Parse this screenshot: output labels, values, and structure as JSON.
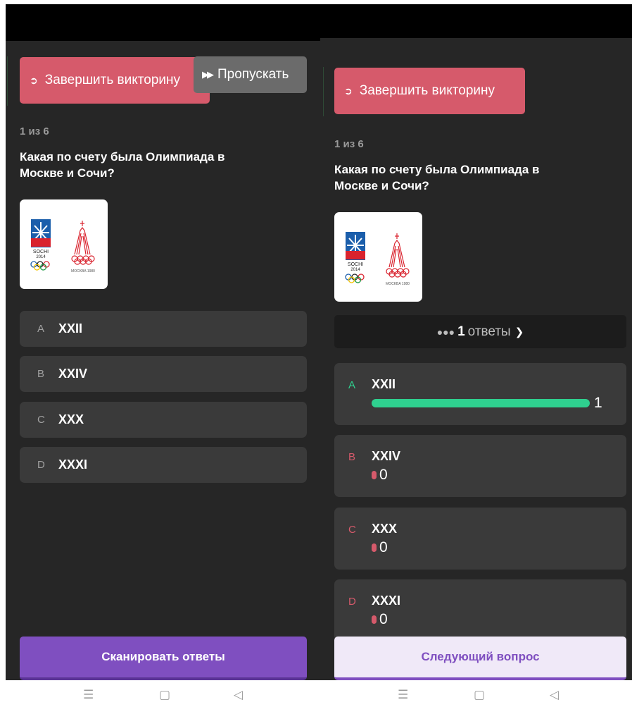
{
  "left": {
    "exit_label": "Завершить викторину",
    "skip_label": "Пропускать",
    "counter": "1 из 6",
    "question": "Какая по счету была Олимпиада в Москве и Сочи?",
    "options": [
      {
        "letter": "A",
        "text": "XXII"
      },
      {
        "letter": "B",
        "text": "XXIV"
      },
      {
        "letter": "C",
        "text": "XXX"
      },
      {
        "letter": "D",
        "text": "XXXI"
      }
    ],
    "scan_label": "Сканировать ответы"
  },
  "right": {
    "exit_label": "Завершить викторину",
    "counter": "1 из 6",
    "question": "Какая по счету была Олимпиада в Москве и Сочи?",
    "answers_count": "1",
    "answers_label": "ответы",
    "options": [
      {
        "letter": "A",
        "text": "XXII",
        "count": "1",
        "share": 1.0,
        "correct": true
      },
      {
        "letter": "B",
        "text": "XXIV",
        "count": "0",
        "share": 0.0,
        "correct": false
      },
      {
        "letter": "C",
        "text": "XXX",
        "count": "0",
        "share": 0.0,
        "correct": false
      },
      {
        "letter": "D",
        "text": "XXXI",
        "count": "0",
        "share": 0.0,
        "correct": false
      }
    ],
    "next_label": "Следующий вопрос"
  },
  "image": {
    "sochi_label": "SOCHI",
    "sochi_year": "2014",
    "moscow_label": "MOCKBA 1980"
  },
  "colors": {
    "exit": "#d65a6b",
    "correct": "#2fd08f",
    "wrong": "#d65a6b",
    "primary": "#7f4fc0"
  },
  "icons": {
    "exit": "sign-out-icon",
    "skip": "fast-forward-icon",
    "users": "users-icon",
    "chevron": "chevron-down-icon",
    "nav_menu": "menu-icon",
    "nav_home": "home-icon",
    "nav_back": "back-icon"
  }
}
